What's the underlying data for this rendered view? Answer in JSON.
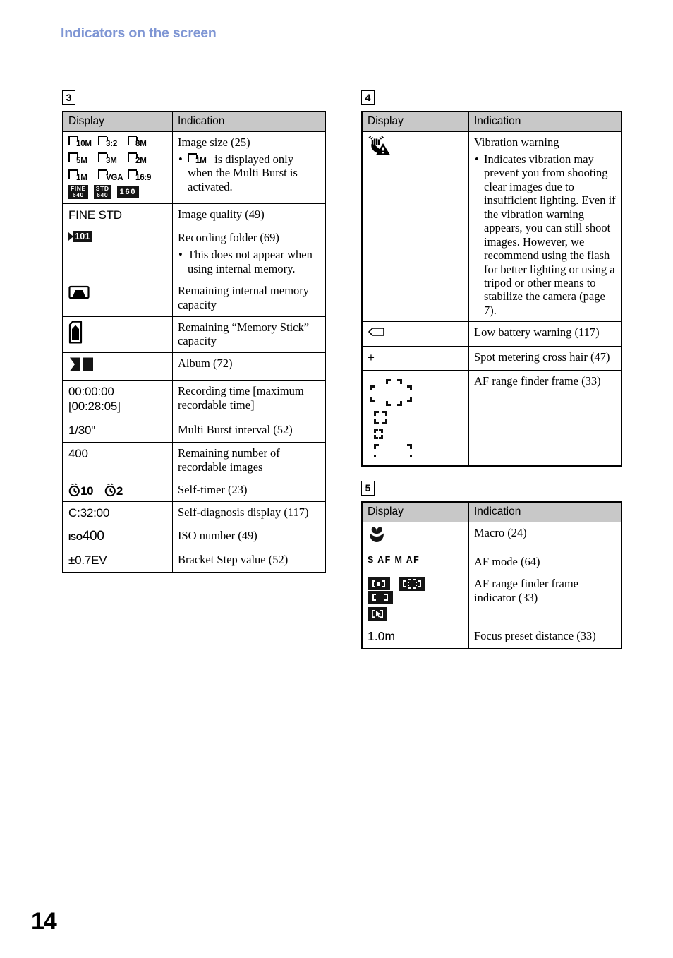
{
  "header": {
    "title": "Indicators on the screen"
  },
  "footer": {
    "page_number": "14"
  },
  "tables": [
    {
      "section": "3",
      "columns": [
        "Display",
        "Indication"
      ],
      "rows": [
        {
          "display_icons": [
            "size-10M",
            "size-3:2",
            "size-8M",
            "size-5M",
            "size-3M",
            "size-2M",
            "size-1M",
            "size-VGA",
            "size-16:9",
            "badge-FINE-640",
            "badge-STD-640",
            "badge-160"
          ],
          "icon_labels": [
            "10M",
            "3:2",
            "8M",
            "5M",
            "3M",
            "2M",
            "1M",
            "VGA",
            "16:9"
          ],
          "badge_labels": [
            {
              "top": "FINE",
              "bottom": "640"
            },
            {
              "top": "STD",
              "bottom": "640"
            },
            {
              "single": "160"
            }
          ],
          "indication": "Image size (25)",
          "note": "is displayed only when the Multi Burst is activated.",
          "note_icon_label": "1M"
        },
        {
          "display_text": "FINE STD",
          "indication": "Image quality (49)"
        },
        {
          "display_icon": "recording-folder-101",
          "folder_number": "101",
          "indication": "Recording folder (69)",
          "note": "This does not appear when using internal memory."
        },
        {
          "display_icon": "internal-memory",
          "indication": "Remaining internal memory capacity"
        },
        {
          "display_icon": "memory-stick",
          "indication": "Remaining “Memory Stick” capacity"
        },
        {
          "display_icon": "album",
          "indication": "Album (72)"
        },
        {
          "display_text": "00:00:00\n[00:28:05]",
          "indication": "Recording time [maximum recordable time]"
        },
        {
          "display_text": "1/30\"",
          "indication": "Multi Burst interval (52)"
        },
        {
          "display_text": "400",
          "indication": "Remaining number of recordable images"
        },
        {
          "display_icon": "self-timer",
          "timer_values": [
            "10",
            "2"
          ],
          "indication": "Self-timer (23)"
        },
        {
          "display_text": "C:32:00",
          "indication": "Self-diagnosis display (117)"
        },
        {
          "display_icon": "iso-number",
          "iso_prefix": "ISO",
          "iso_value": "400",
          "indication": "ISO number (49)"
        },
        {
          "display_text": "±0.7EV",
          "indication": "Bracket Step value (52)"
        }
      ]
    },
    {
      "section": "4",
      "columns": [
        "Display",
        "Indication"
      ],
      "rows": [
        {
          "display_icon": "vibration-warning",
          "indication": "Vibration warning",
          "note": "Indicates vibration may prevent you from shooting clear images due to insufficient lighting. Even if the vibration warning appears, you can still shoot images. However, we recommend using the flash for better lighting or using a tripod or other means to stabilize the camera (page 7)."
        },
        {
          "display_icon": "low-battery",
          "indication": "Low battery warning (117)"
        },
        {
          "display_text": "+",
          "indication": "Spot metering cross hair (47)"
        },
        {
          "display_icon": "af-range-finder-frame",
          "indication": "AF range finder frame (33)"
        }
      ]
    },
    {
      "section": "5",
      "columns": [
        "Display",
        "Indication"
      ],
      "rows": [
        {
          "display_icon": "macro",
          "indication": "Macro (24)"
        },
        {
          "display_text": "S AF  M AF",
          "indication": "AF mode (64)"
        },
        {
          "display_icon": "af-range-finder-frame-indicator",
          "indication": "AF range finder frame indicator (33)"
        },
        {
          "display_text": "1.0m",
          "indication": "Focus preset distance (33)"
        }
      ]
    }
  ]
}
